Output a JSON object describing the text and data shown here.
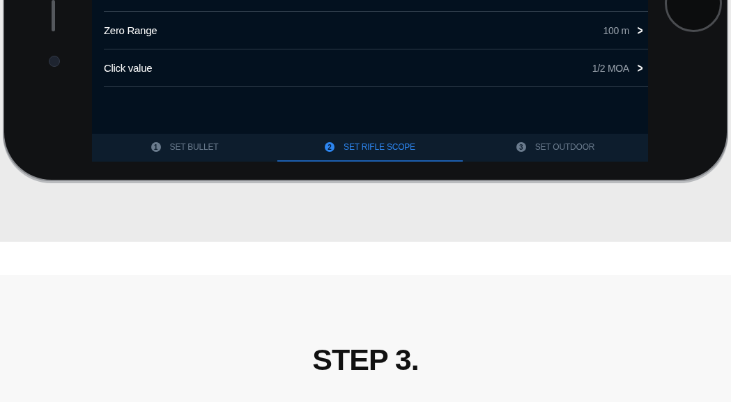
{
  "settings": [
    {
      "label": "Zero Range",
      "value": "100 m",
      "chevron": ">"
    },
    {
      "label": "Click value",
      "value": "1/2 MOA",
      "chevron": ">"
    }
  ],
  "steps": [
    {
      "number": "1",
      "label": "SET BULLET",
      "selected": false
    },
    {
      "number": "2",
      "label": "SET RIFLE SCOPE",
      "selected": true
    },
    {
      "number": "3",
      "label": "SET OUTDOOR",
      "selected": false
    }
  ],
  "heading": "STEP 3."
}
